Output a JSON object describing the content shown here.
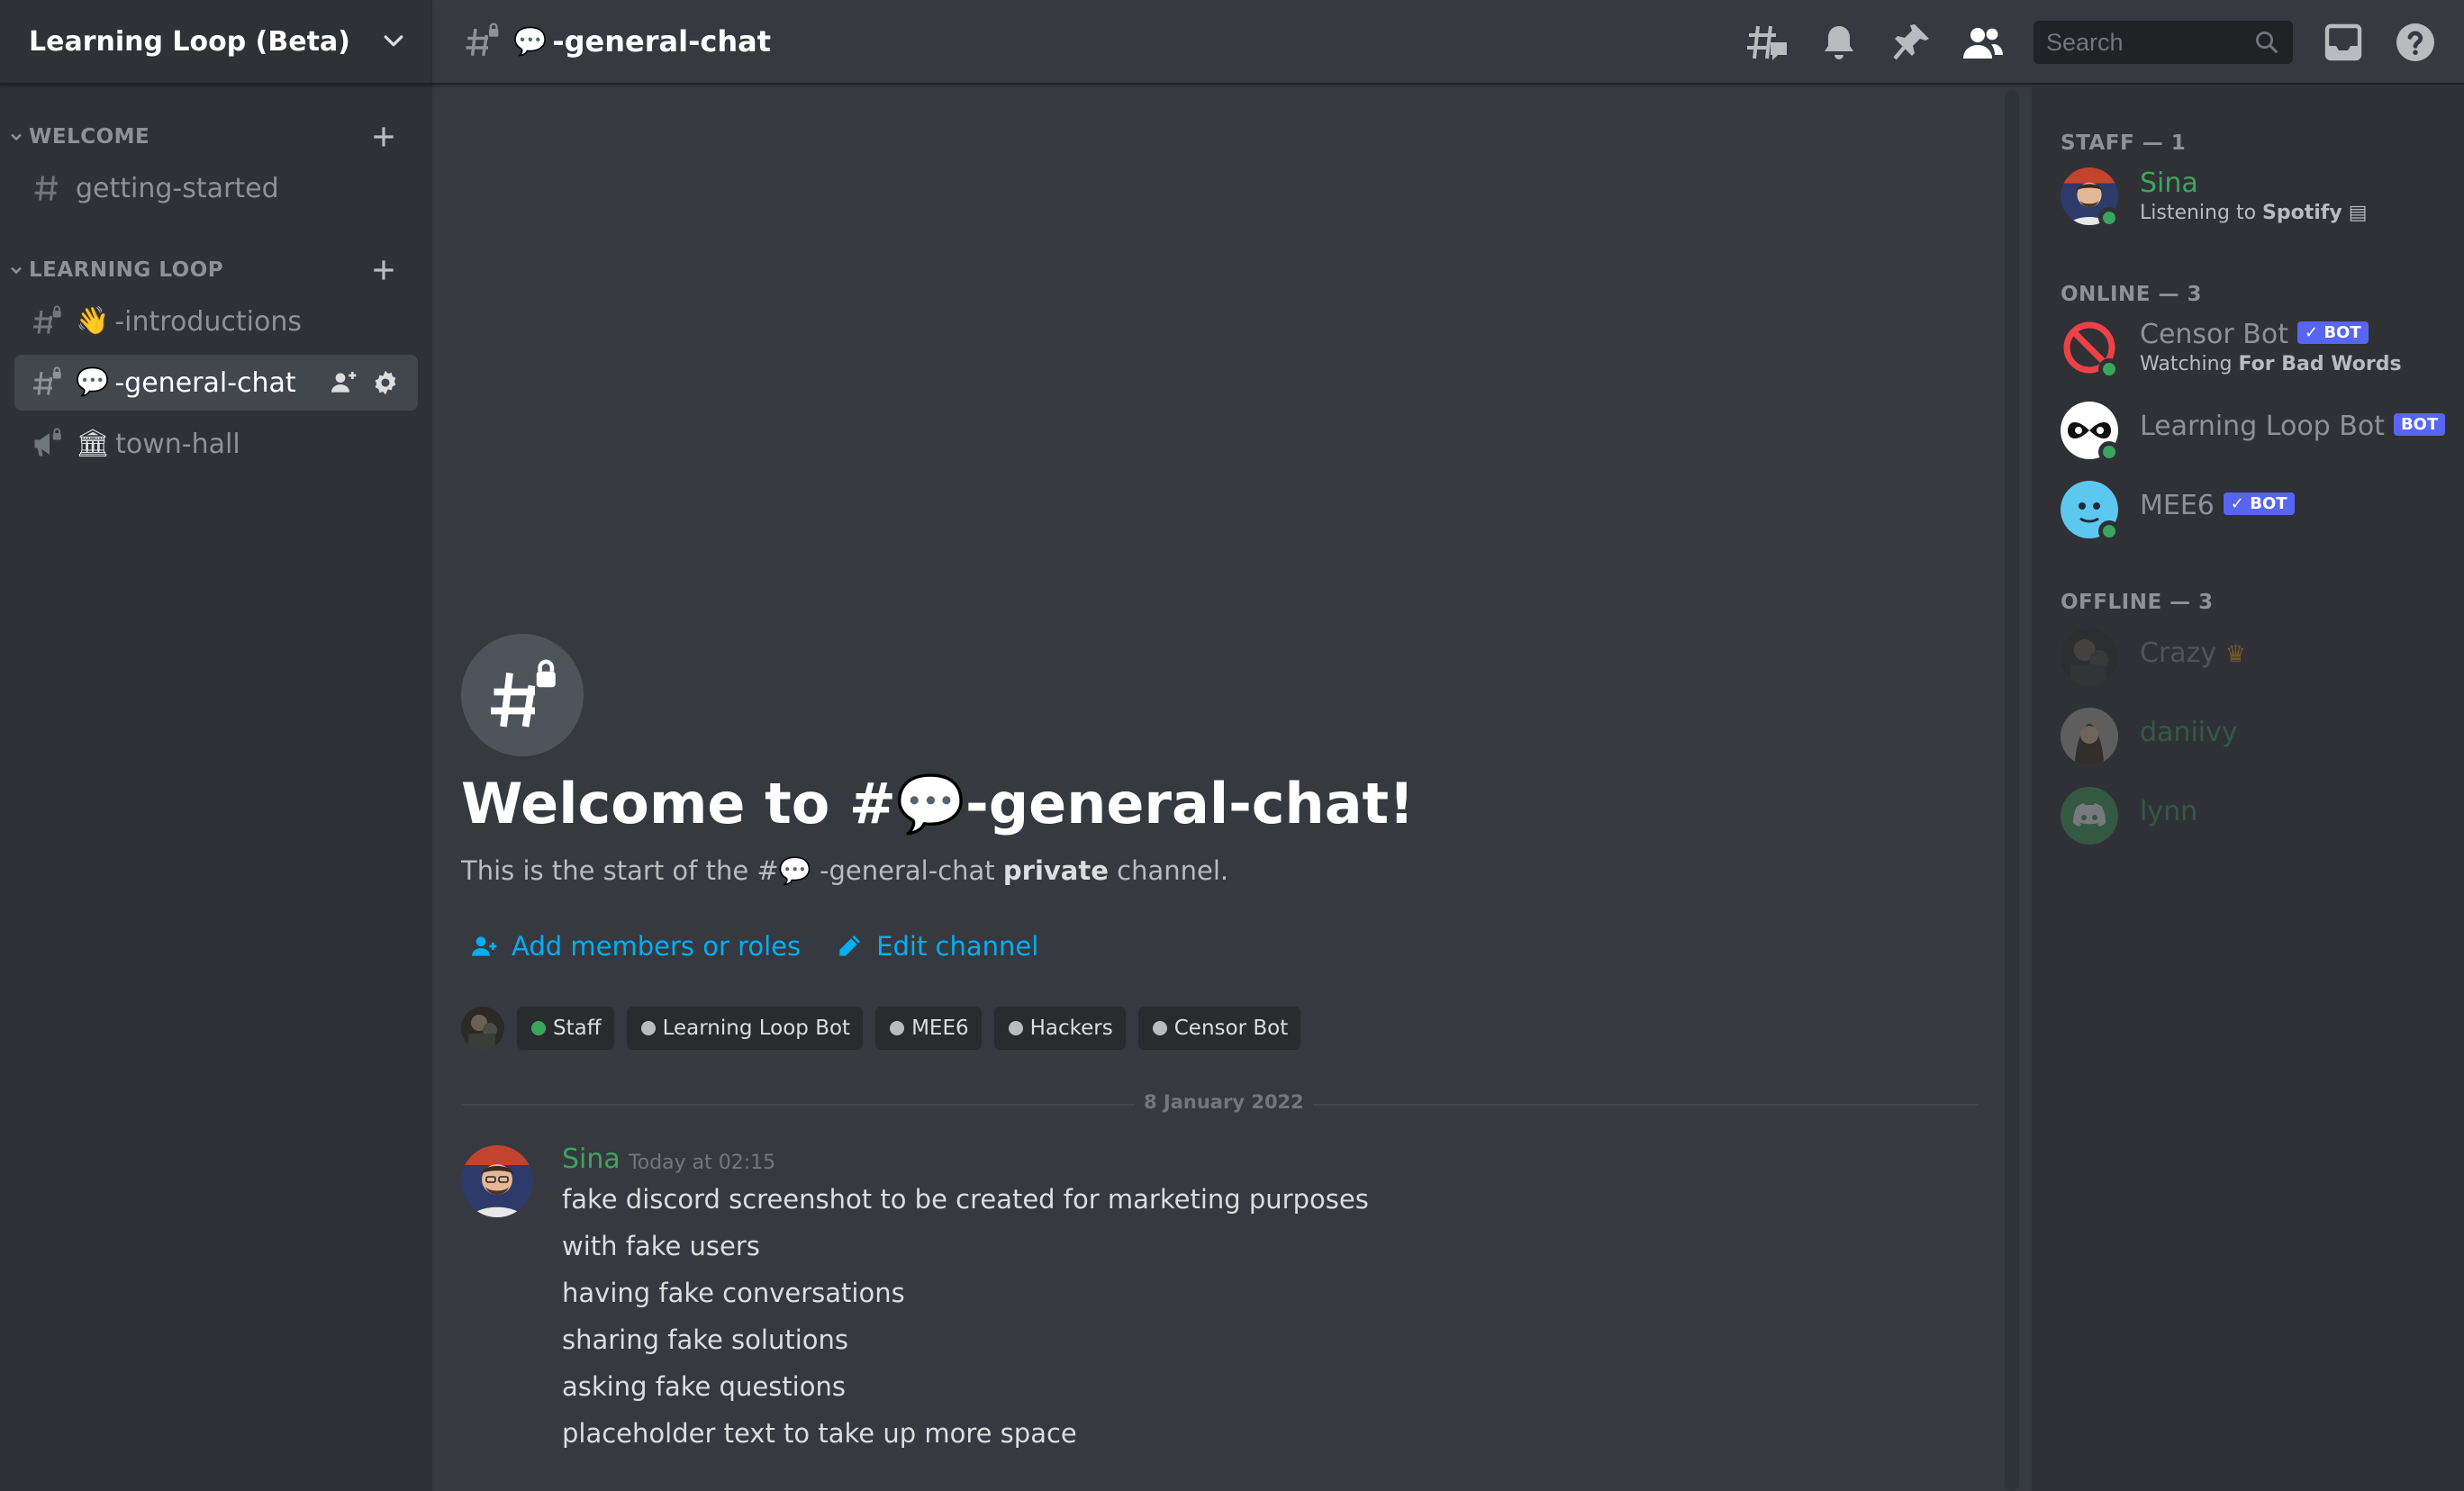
{
  "server": {
    "name": "Learning Loop (Beta)"
  },
  "sidebar": {
    "categories": [
      {
        "label": "WELCOME"
      },
      {
        "label": "LEARNING LOOP"
      }
    ],
    "channels": [
      {
        "label": "getting-started",
        "emoji": ""
      },
      {
        "label": "-introductions",
        "emoji": "👋"
      },
      {
        "label": "-general-chat",
        "emoji": "💬"
      },
      {
        "label": "town-hall",
        "emoji": "🏛"
      }
    ]
  },
  "topbar": {
    "channel_emoji": "💬",
    "channel_name": "-general-chat",
    "search_placeholder": "Search"
  },
  "chat": {
    "welcome_title_prefix": "Welcome to #",
    "welcome_title_emoji": "💬",
    "welcome_title_suffix": "-general-chat!",
    "sub_prefix": "This is the start of the #",
    "sub_emoji": "💬",
    "sub_channel": " -general-chat ",
    "sub_bold": "private",
    "sub_suffix": " channel.",
    "add_members_label": "Add members or roles",
    "edit_channel_label": "Edit channel",
    "roles": [
      {
        "label": "Staff",
        "color": "#3ba55d"
      },
      {
        "label": "Learning Loop Bot",
        "color": "#b9bbbe"
      },
      {
        "label": "MEE6",
        "color": "#b9bbbe"
      },
      {
        "label": "Hackers",
        "color": "#b9bbbe"
      },
      {
        "label": "Censor Bot",
        "color": "#b9bbbe"
      }
    ],
    "date_divider": "8 January 2022",
    "message": {
      "author": "Sina",
      "time": "Today at 02:15",
      "lines": [
        "fake discord screenshot to be created for marketing purposes",
        "with fake users",
        "having fake conversations",
        "sharing fake solutions",
        "asking fake questions",
        "placeholder text to take up more space"
      ]
    }
  },
  "members": {
    "staff_heading": "STAFF — 1",
    "online_heading": "ONLINE — 3",
    "offline_heading": "OFFLINE — 3",
    "sina": {
      "name": "Sina",
      "status_prefix": "Listening to ",
      "status_bold": "Spotify"
    },
    "censor": {
      "name": "Censor Bot",
      "tag": "✓ BOT",
      "status_prefix": "Watching ",
      "status_bold": "For Bad Words"
    },
    "llbot": {
      "name": "Learning Loop Bot",
      "tag": "BOT"
    },
    "mee6": {
      "name": "MEE6",
      "tag": "✓ BOT"
    },
    "crazy": {
      "name": "Crazy"
    },
    "daniivy": {
      "name": "daniivy"
    },
    "lynn": {
      "name": "lynn"
    }
  },
  "colors": {
    "accent": "#5865f2",
    "link": "#00aff4",
    "online": "#3ba55d",
    "staff_name": "#3ba55d"
  }
}
